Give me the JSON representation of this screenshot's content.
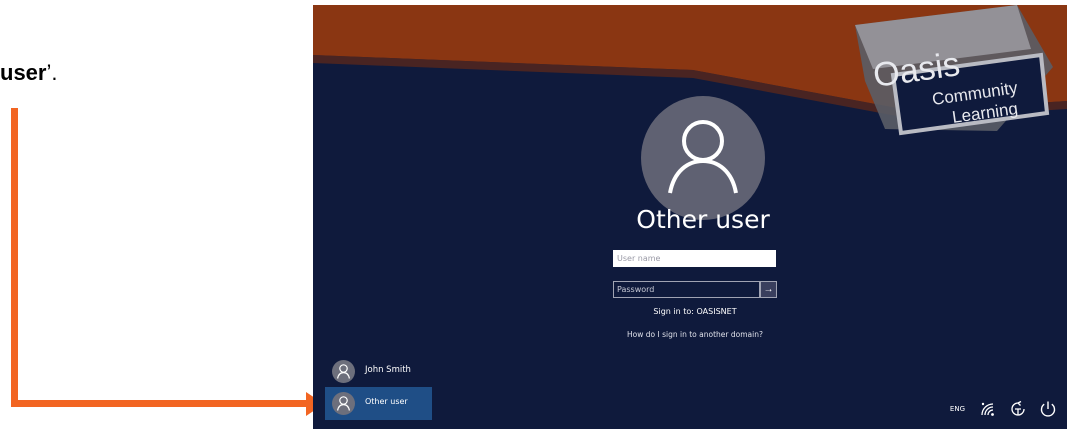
{
  "caption": {
    "bold": "user",
    "tail": "’."
  },
  "colors": {
    "arrow": "#f26522",
    "background": "#0f1a3c",
    "banner": "#8a3612",
    "selected_tile": "#1f4e86"
  },
  "logo": {
    "brand": "Oasis",
    "line1": "Community",
    "line2": "Learning"
  },
  "login": {
    "avatar_icon": "user-icon",
    "title": "Other user",
    "username_placeholder": "User name",
    "password_placeholder": "Password",
    "submit_icon": "→",
    "sign_in_to": "Sign in to: OASISNET",
    "other_domain_link": "How do I sign in to another domain?"
  },
  "users": [
    {
      "name": "John Smith",
      "selected": false
    },
    {
      "name": "Other user",
      "selected": true
    }
  ],
  "tray": {
    "language": "ENG",
    "icons": [
      "network-icon",
      "ease-of-access-icon",
      "power-icon"
    ]
  }
}
